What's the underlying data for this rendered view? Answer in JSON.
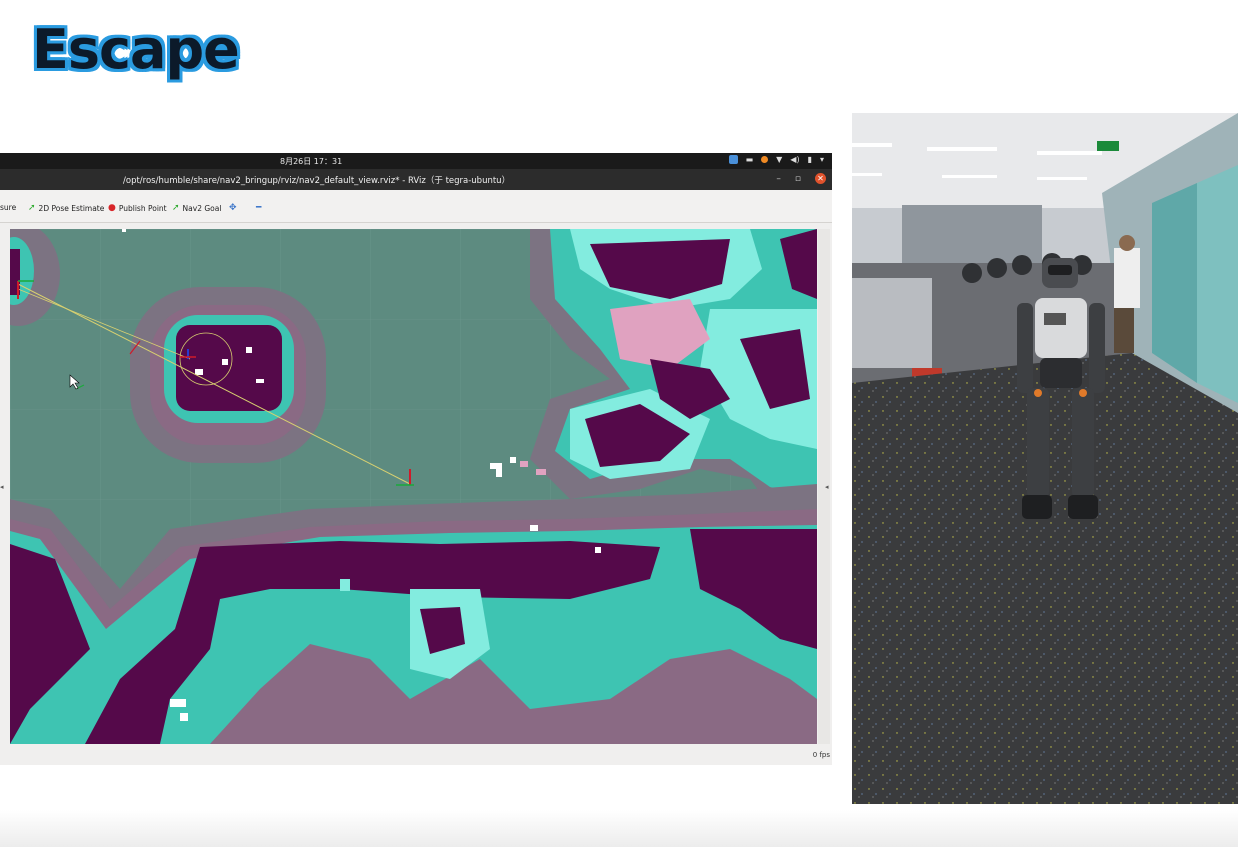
{
  "slide": {
    "title": "Escape"
  },
  "desktop": {
    "clock": "8月26日 17：31",
    "window_title": "/opt/ros/humble/share/nav2_bringup/rviz/nav2_default_view.rviz* - RViz（于 tegra-ubuntu）"
  },
  "toolbar": {
    "measure_label": "sure",
    "pose_label": "2D Pose Estimate",
    "publish_label": "Publish Point",
    "goal_label": "Nav2 Goal",
    "add_label": "✥",
    "remove_label": "━"
  },
  "viewport": {
    "fps": "0 fps"
  },
  "colors": {
    "free": "#5d8b80",
    "inflation_outer": "#7c7382",
    "inflation_mid": "#8a6a84",
    "inscribed": "#3ec4b2",
    "lethal": "#55094a",
    "unknown": "#83ecdf",
    "pink": "#e0a2c0",
    "path": "#d8d070"
  }
}
